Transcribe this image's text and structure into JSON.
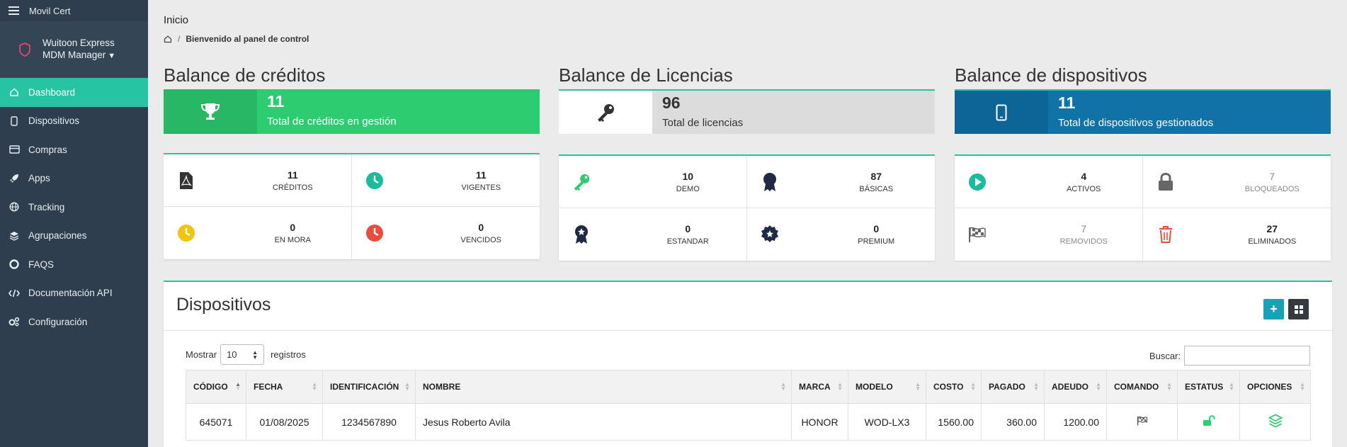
{
  "app": {
    "name": "Movil Cert"
  },
  "account": {
    "line1": "Wuitoon Express",
    "line2": "MDM Manager"
  },
  "sidebar": {
    "items": [
      {
        "label": "Dashboard",
        "icon": "home-icon"
      },
      {
        "label": "Dispositivos",
        "icon": "phone-icon"
      },
      {
        "label": "Compras",
        "icon": "card-icon"
      },
      {
        "label": "Apps",
        "icon": "rocket-icon"
      },
      {
        "label": "Tracking",
        "icon": "globe-icon"
      },
      {
        "label": "Agrupaciones",
        "icon": "layers-icon"
      },
      {
        "label": "FAQS",
        "icon": "lifebuoy-icon"
      },
      {
        "label": "Documentación API",
        "icon": "code-icon"
      },
      {
        "label": "Configuración",
        "icon": "cogs-icon"
      }
    ]
  },
  "header": {
    "title": "Inicio",
    "breadcrumb": "Bienvenido al panel de control"
  },
  "creditos": {
    "title": "Balance de créditos",
    "total": "11",
    "total_label": "Total de créditos en gestión",
    "stats": [
      {
        "value": "11",
        "label": "CRÉDITOS"
      },
      {
        "value": "11",
        "label": "VIGENTES"
      },
      {
        "value": "0",
        "label": "EN MORA"
      },
      {
        "value": "0",
        "label": "VENCIDOS"
      }
    ]
  },
  "licencias": {
    "title": "Balance de Licencias",
    "total": "96",
    "total_label": "Total de licencias",
    "stats": [
      {
        "value": "10",
        "label": "DEMO"
      },
      {
        "value": "87",
        "label": "BÁSICAS"
      },
      {
        "value": "0",
        "label": "ESTANDAR"
      },
      {
        "value": "0",
        "label": "PREMIUM"
      }
    ]
  },
  "dispositivos_bal": {
    "title": "Balance de dispositivos",
    "total": "11",
    "total_label": "Total de dispositivos gestionados",
    "stats": [
      {
        "value": "4",
        "label": "ACTIVOS"
      },
      {
        "value": "7",
        "label": "BLOQUEADOS"
      },
      {
        "value": "7",
        "label": "REMOVIDOS"
      },
      {
        "value": "27",
        "label": "ELIMINADOS"
      }
    ]
  },
  "devices": {
    "title": "Dispositivos",
    "show_label": "Mostrar",
    "show_value": "10",
    "records_label": "registros",
    "search_label": "Buscar:",
    "search_value": "",
    "columns": [
      "CÓDIGO",
      "FECHA",
      "IDENTIFICACIÓN",
      "NOMBRE",
      "MARCA",
      "MODELO",
      "COSTO",
      "PAGADO",
      "ADEUDO",
      "COMANDO",
      "ESTATUS",
      "OPCIONES"
    ],
    "rows": [
      {
        "codigo": "645071",
        "fecha": "01/08/2025",
        "identificacion": "1234567890",
        "nombre": "Jesus Roberto Avila",
        "marca": "HONOR",
        "modelo": "WOD-LX3",
        "costo": "1560.00",
        "pagado": "360.00",
        "adeudo": "1200.00"
      }
    ]
  },
  "colors": {
    "sidebar": "#2e3e4e",
    "active": "#27c4a3",
    "green": "#2ecc71",
    "gray": "#dcdcdc",
    "blue": "#1172a8"
  }
}
